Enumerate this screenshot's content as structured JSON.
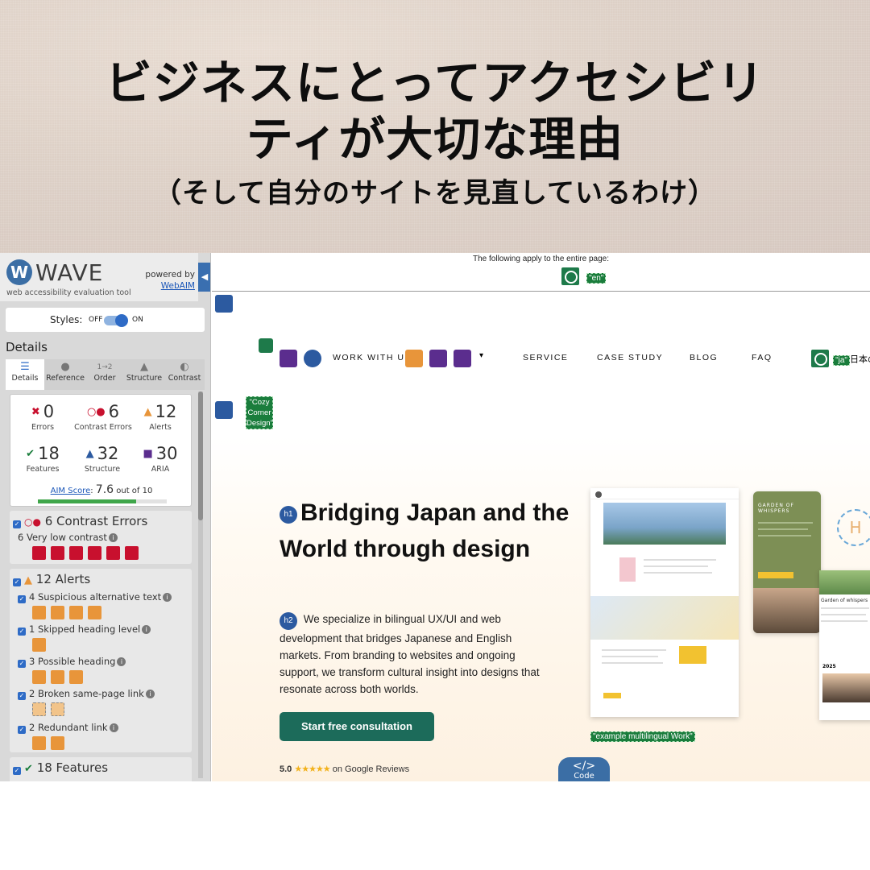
{
  "banner": {
    "title_line1": "ビジネスにとってアクセシビリ",
    "title_line2": "ティが大切な理由",
    "subtitle": "（そして自分のサイトを見直しているわけ）"
  },
  "wave": {
    "logo_letter": "W",
    "name": "WAVE",
    "tagline": "web accessibility evaluation tool",
    "powered_by": "powered by",
    "powered_link": "WebAIM",
    "styles_label": "Styles:",
    "styles_off": "OFF",
    "styles_on": "ON",
    "details_heading": "Details",
    "tabs": [
      {
        "label": "Details",
        "icon": "list-icon"
      },
      {
        "label": "Reference",
        "icon": "info-icon"
      },
      {
        "label": "Order",
        "icon": "order-icon"
      },
      {
        "label": "Structure",
        "icon": "structure-icon"
      },
      {
        "label": "Contrast",
        "icon": "contrast-icon"
      }
    ],
    "summary": {
      "errors": {
        "count": "0",
        "label": "Errors"
      },
      "contrast": {
        "count": "6",
        "label": "Contrast Errors"
      },
      "alerts": {
        "count": "12",
        "label": "Alerts"
      },
      "features": {
        "count": "18",
        "label": "Features"
      },
      "structure": {
        "count": "32",
        "label": "Structure"
      },
      "aria": {
        "count": "30",
        "label": "ARIA"
      },
      "aim_label": "AIM Score",
      "aim_value": "7.6",
      "aim_suffix": "out of 10",
      "aim_fraction": 0.76
    },
    "contrast_panel": {
      "heading": "6 Contrast Errors",
      "row1": "6 Very low contrast",
      "icon_count": 6
    },
    "alerts_panel": {
      "heading": "12 Alerts",
      "rows": [
        {
          "label": "4 Suspicious alternative text",
          "icons": 4
        },
        {
          "label": "1 Skipped heading level",
          "icons": 1
        },
        {
          "label": "3 Possible heading",
          "icons": 3
        },
        {
          "label": "2 Broken same-page link",
          "icons": 2
        },
        {
          "label": "2 Redundant link",
          "icons": 2
        }
      ]
    },
    "features_panel": {
      "heading": "18 Features"
    }
  },
  "site": {
    "apply_text": "The following apply to the entire page:",
    "lang_label": "\"en\"",
    "logo_alt": "\"Cozy Corner Design\"",
    "nav": [
      "WORK WITH US",
      "SERVICE",
      "CASE STUDY",
      "BLOG",
      "FAQ"
    ],
    "dropdown_caret": "▾",
    "lang_ja": "\"ja\"",
    "lang_ja_text": "日本の",
    "h1_tag": "h1",
    "h1": "Bridging Japan and the World through design",
    "h2_tag": "h2",
    "paragraph": "We specialize in bilingual UX/UI and web development that bridges Japanese and English markets. From branding to websites and ongoing support, we transform cultural insight into designs that resonate across both worlds.",
    "cta": "Start free consultation",
    "rating": "5.0",
    "stars": "★★★★★",
    "reviews_text": "on Google Reviews",
    "example_label": "\"example multilingual Work\"",
    "code_badge_symbol": "</>",
    "code_badge_text": "Code",
    "mock_garden_title": "GARDEN OF WHISPERS",
    "mock_garden_sub": "Garden of whispers",
    "mock_year": "2025",
    "mock_h_letter": "H"
  },
  "colors": {
    "wave_blue": "#2e6bc6",
    "error_red": "#c8102e",
    "alert_orange": "#e8953a",
    "feature_green": "#1a7d3c",
    "cta_green": "#1c6b5a"
  }
}
